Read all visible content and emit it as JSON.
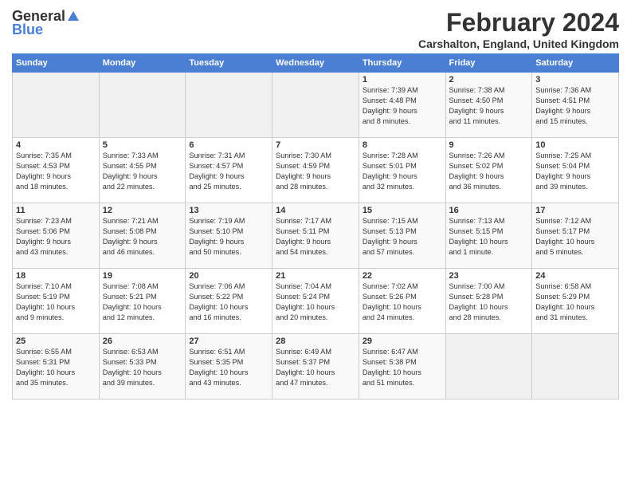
{
  "header": {
    "logo_general": "General",
    "logo_blue": "Blue",
    "title": "February 2024",
    "subtitle": "Carshalton, England, United Kingdom"
  },
  "weekdays": [
    "Sunday",
    "Monday",
    "Tuesday",
    "Wednesday",
    "Thursday",
    "Friday",
    "Saturday"
  ],
  "weeks": [
    [
      {
        "day": "",
        "info": ""
      },
      {
        "day": "",
        "info": ""
      },
      {
        "day": "",
        "info": ""
      },
      {
        "day": "",
        "info": ""
      },
      {
        "day": "1",
        "info": "Sunrise: 7:39 AM\nSunset: 4:48 PM\nDaylight: 9 hours\nand 8 minutes."
      },
      {
        "day": "2",
        "info": "Sunrise: 7:38 AM\nSunset: 4:50 PM\nDaylight: 9 hours\nand 11 minutes."
      },
      {
        "day": "3",
        "info": "Sunrise: 7:36 AM\nSunset: 4:51 PM\nDaylight: 9 hours\nand 15 minutes."
      }
    ],
    [
      {
        "day": "4",
        "info": "Sunrise: 7:35 AM\nSunset: 4:53 PM\nDaylight: 9 hours\nand 18 minutes."
      },
      {
        "day": "5",
        "info": "Sunrise: 7:33 AM\nSunset: 4:55 PM\nDaylight: 9 hours\nand 22 minutes."
      },
      {
        "day": "6",
        "info": "Sunrise: 7:31 AM\nSunset: 4:57 PM\nDaylight: 9 hours\nand 25 minutes."
      },
      {
        "day": "7",
        "info": "Sunrise: 7:30 AM\nSunset: 4:59 PM\nDaylight: 9 hours\nand 28 minutes."
      },
      {
        "day": "8",
        "info": "Sunrise: 7:28 AM\nSunset: 5:01 PM\nDaylight: 9 hours\nand 32 minutes."
      },
      {
        "day": "9",
        "info": "Sunrise: 7:26 AM\nSunset: 5:02 PM\nDaylight: 9 hours\nand 36 minutes."
      },
      {
        "day": "10",
        "info": "Sunrise: 7:25 AM\nSunset: 5:04 PM\nDaylight: 9 hours\nand 39 minutes."
      }
    ],
    [
      {
        "day": "11",
        "info": "Sunrise: 7:23 AM\nSunset: 5:06 PM\nDaylight: 9 hours\nand 43 minutes."
      },
      {
        "day": "12",
        "info": "Sunrise: 7:21 AM\nSunset: 5:08 PM\nDaylight: 9 hours\nand 46 minutes."
      },
      {
        "day": "13",
        "info": "Sunrise: 7:19 AM\nSunset: 5:10 PM\nDaylight: 9 hours\nand 50 minutes."
      },
      {
        "day": "14",
        "info": "Sunrise: 7:17 AM\nSunset: 5:11 PM\nDaylight: 9 hours\nand 54 minutes."
      },
      {
        "day": "15",
        "info": "Sunrise: 7:15 AM\nSunset: 5:13 PM\nDaylight: 9 hours\nand 57 minutes."
      },
      {
        "day": "16",
        "info": "Sunrise: 7:13 AM\nSunset: 5:15 PM\nDaylight: 10 hours\nand 1 minute."
      },
      {
        "day": "17",
        "info": "Sunrise: 7:12 AM\nSunset: 5:17 PM\nDaylight: 10 hours\nand 5 minutes."
      }
    ],
    [
      {
        "day": "18",
        "info": "Sunrise: 7:10 AM\nSunset: 5:19 PM\nDaylight: 10 hours\nand 9 minutes."
      },
      {
        "day": "19",
        "info": "Sunrise: 7:08 AM\nSunset: 5:21 PM\nDaylight: 10 hours\nand 12 minutes."
      },
      {
        "day": "20",
        "info": "Sunrise: 7:06 AM\nSunset: 5:22 PM\nDaylight: 10 hours\nand 16 minutes."
      },
      {
        "day": "21",
        "info": "Sunrise: 7:04 AM\nSunset: 5:24 PM\nDaylight: 10 hours\nand 20 minutes."
      },
      {
        "day": "22",
        "info": "Sunrise: 7:02 AM\nSunset: 5:26 PM\nDaylight: 10 hours\nand 24 minutes."
      },
      {
        "day": "23",
        "info": "Sunrise: 7:00 AM\nSunset: 5:28 PM\nDaylight: 10 hours\nand 28 minutes."
      },
      {
        "day": "24",
        "info": "Sunrise: 6:58 AM\nSunset: 5:29 PM\nDaylight: 10 hours\nand 31 minutes."
      }
    ],
    [
      {
        "day": "25",
        "info": "Sunrise: 6:55 AM\nSunset: 5:31 PM\nDaylight: 10 hours\nand 35 minutes."
      },
      {
        "day": "26",
        "info": "Sunrise: 6:53 AM\nSunset: 5:33 PM\nDaylight: 10 hours\nand 39 minutes."
      },
      {
        "day": "27",
        "info": "Sunrise: 6:51 AM\nSunset: 5:35 PM\nDaylight: 10 hours\nand 43 minutes."
      },
      {
        "day": "28",
        "info": "Sunrise: 6:49 AM\nSunset: 5:37 PM\nDaylight: 10 hours\nand 47 minutes."
      },
      {
        "day": "29",
        "info": "Sunrise: 6:47 AM\nSunset: 5:38 PM\nDaylight: 10 hours\nand 51 minutes."
      },
      {
        "day": "",
        "info": ""
      },
      {
        "day": "",
        "info": ""
      }
    ]
  ]
}
